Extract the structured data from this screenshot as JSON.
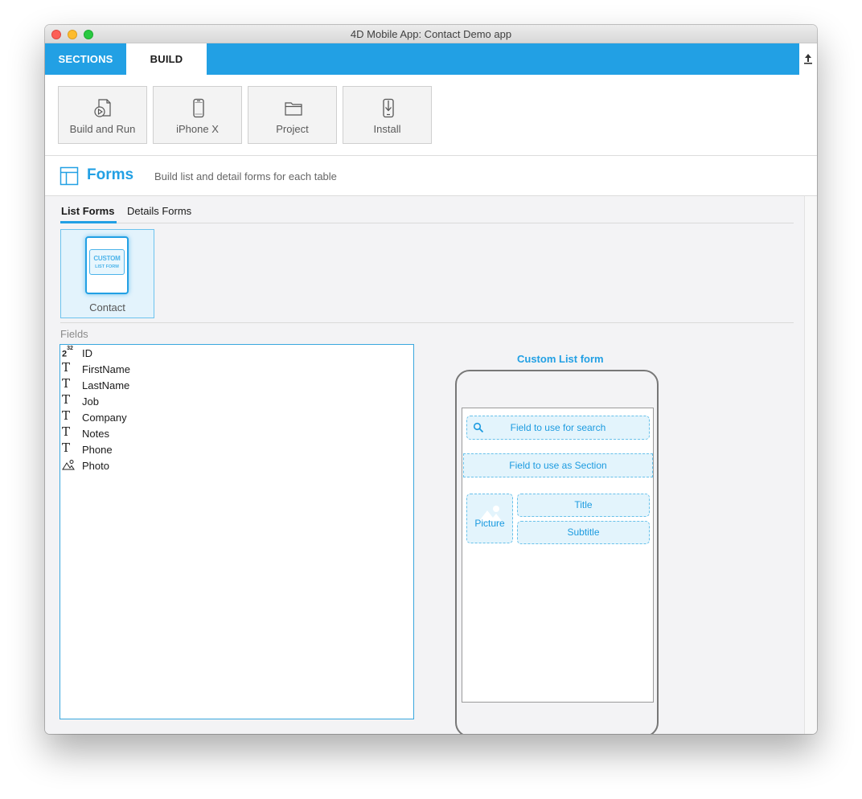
{
  "window": {
    "title": "4D Mobile App: Contact Demo app"
  },
  "tabs": {
    "sections": "SECTIONS",
    "build": "BUILD"
  },
  "toolbar": {
    "build_and_run": "Build and Run",
    "device": "iPhone X",
    "project": "Project",
    "install": "Install"
  },
  "forms": {
    "title": "Forms",
    "subtitle": "Build list and detail forms for each table",
    "subtabs": {
      "list": "List Forms",
      "details": "Details Forms"
    },
    "tile": {
      "line1": "CUSTOM",
      "line2": "LIST FORM",
      "label": "Contact"
    }
  },
  "fields": {
    "label": "Fields",
    "items": [
      {
        "name": "ID",
        "type": "integer",
        "icon": "integer-icon",
        "glyph": "2",
        "sup": "32"
      },
      {
        "name": "FirstName",
        "type": "text",
        "icon": "text-icon",
        "glyph": "T"
      },
      {
        "name": "LastName",
        "type": "text",
        "icon": "text-icon",
        "glyph": "T"
      },
      {
        "name": "Job",
        "type": "text",
        "icon": "text-icon",
        "glyph": "T"
      },
      {
        "name": "Company",
        "type": "text",
        "icon": "text-icon",
        "glyph": "T"
      },
      {
        "name": "Notes",
        "type": "text",
        "icon": "text-icon",
        "glyph": "T"
      },
      {
        "name": "Phone",
        "type": "text",
        "icon": "text-icon",
        "glyph": "T"
      },
      {
        "name": "Photo",
        "type": "picture",
        "icon": "picture-icon"
      }
    ]
  },
  "preview": {
    "title": "Custom List form",
    "search": "Field to use for search",
    "section": "Field to use as Section",
    "picture": "Picture",
    "title_zone": "Title",
    "subtitle_zone": "Subtitle"
  },
  "colors": {
    "accent": "#22a0e4",
    "zone_fill": "#e3f4fc",
    "zone_border": "#68c1ea"
  }
}
